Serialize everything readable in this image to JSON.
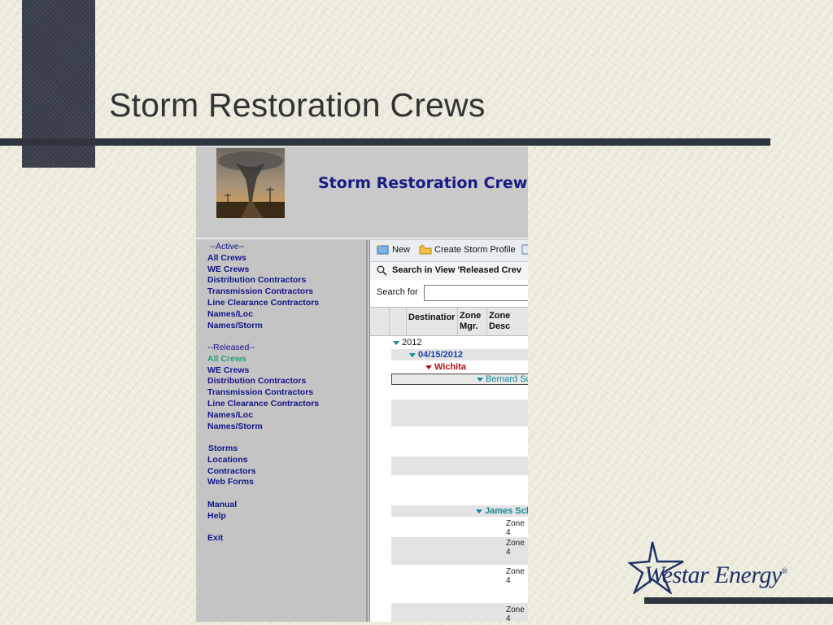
{
  "slide": {
    "title": "Storm Restoration Crews",
    "logo_text": "Westar Energy",
    "logo_mark": "®"
  },
  "app": {
    "title": "Storm Restoration Crews",
    "nav": {
      "active_header": "--Active--",
      "active_items": [
        "All Crews",
        "WE Crews",
        "Distribution Contractors",
        "Transmission Contractors",
        "Line Clearance Contractors",
        "Names/Loc",
        "Names/Storm"
      ],
      "released_header": "--Released--",
      "released_items": [
        "All Crews",
        "WE Crews",
        "Distribution Contractors",
        "Transmission Contractors",
        "Line Clearance Contractors",
        "Names/Loc",
        "Names/Storm"
      ],
      "other_items": [
        "Storms",
        "Locations",
        "Contractors",
        "Web Forms"
      ],
      "help_items": [
        "Manual",
        "Help"
      ],
      "exit": "Exit"
    },
    "toolbar": {
      "new_label": "New",
      "create_label": "Create Storm Profile"
    },
    "search": {
      "header": "Search in View 'Released Crev",
      "label": "Search for",
      "value": ""
    },
    "grid": {
      "columns": [
        "Destinatior",
        "Zone Mgr.",
        "Zone Desc"
      ],
      "rows": {
        "year": "2012",
        "date": "04/15/2012",
        "location": "Wichita",
        "group1": "Bernard Sc",
        "group2": "James Sch",
        "zone": "Zone 4"
      }
    }
  },
  "colors": {
    "slide_text": "#333333",
    "dark_bar": "#2f343e",
    "app_title": "#1b1b85",
    "nav_link": "#14148a",
    "nav_active": "#1ea07a",
    "date_text": "#1a3fa8",
    "location_text": "#b01010",
    "group_text": "#14889a"
  }
}
